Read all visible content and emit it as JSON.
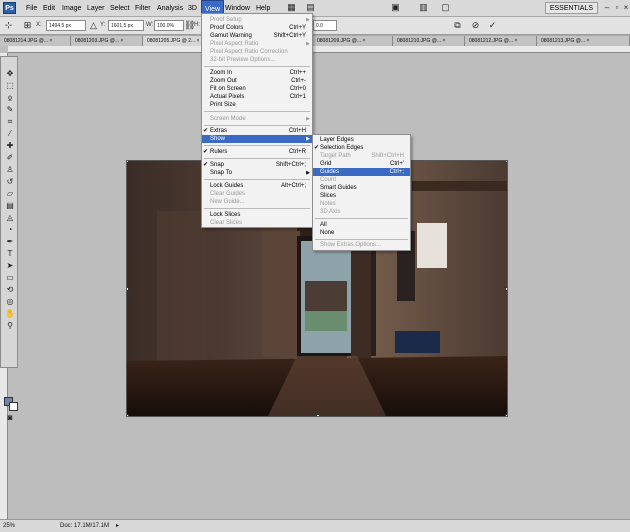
{
  "app": {
    "logo": "Ps"
  },
  "menubar": {
    "items": [
      "File",
      "Edit",
      "Image",
      "Layer",
      "Select",
      "Filter",
      "Analysis",
      "3D",
      "View",
      "Window",
      "Help"
    ],
    "workspace": "ESSENTIALS"
  },
  "options": {
    "x_label": "X:",
    "x_value": "1494.5 px",
    "y_label": "Y:",
    "y_value": "1601.5 px",
    "w_label": "W:",
    "w_value": "100.0%",
    "h_label": "H:",
    "v_value": "0.0"
  },
  "tabs": [
    "08081214.JPG @...",
    "08081203.JPG @...",
    "08081205.JPG @ 2...",
    "08081209.JPG @...",
    "08081210.JPG @...",
    "08081212.JPG @...",
    "08081213.JPG @..."
  ],
  "status": {
    "zoom": "25%",
    "doc": "Doc: 17.1M/17.1M"
  },
  "view_menu": {
    "items": [
      {
        "label": "Proof Setup",
        "shortcut": "",
        "disabled": true,
        "submenu": true
      },
      {
        "label": "Proof Colors",
        "shortcut": "Ctrl+Y"
      },
      {
        "label": "Gamut Warning",
        "shortcut": "Shift+Ctrl+Y"
      },
      {
        "label": "Pixel Aspect Ratio",
        "shortcut": "",
        "disabled": true,
        "submenu": true
      },
      {
        "label": "Pixel Aspect Ratio Correction",
        "shortcut": "",
        "disabled": true
      },
      {
        "label": "32-bit Preview Options...",
        "shortcut": "",
        "disabled": true
      },
      {
        "label": "Zoom In",
        "shortcut": "Ctrl++"
      },
      {
        "label": "Zoom Out",
        "shortcut": "Ctrl+-"
      },
      {
        "label": "Fit on Screen",
        "shortcut": "Ctrl+0"
      },
      {
        "label": "Actual Pixels",
        "shortcut": "Ctrl+1"
      },
      {
        "label": "Print Size",
        "shortcut": ""
      },
      {
        "label": "Screen Mode",
        "shortcut": "",
        "disabled": true,
        "submenu": true
      },
      {
        "label": "Extras",
        "shortcut": "Ctrl+H",
        "checked": true
      },
      {
        "label": "Show",
        "shortcut": "",
        "submenu": true,
        "highlighted": true
      },
      {
        "label": "Rulers",
        "shortcut": "Ctrl+R",
        "checked": true
      },
      {
        "label": "Snap",
        "shortcut": "Shift+Ctrl+;",
        "checked": true
      },
      {
        "label": "Snap To",
        "shortcut": "",
        "submenu": true
      },
      {
        "label": "Lock Guides",
        "shortcut": "Alt+Ctrl+;"
      },
      {
        "label": "Clear Guides",
        "shortcut": "",
        "disabled": true
      },
      {
        "label": "New Guide...",
        "shortcut": "",
        "disabled": true
      },
      {
        "label": "Lock Slices",
        "shortcut": ""
      },
      {
        "label": "Clear Slices",
        "shortcut": "",
        "disabled": true
      }
    ]
  },
  "show_menu": {
    "items": [
      {
        "label": "Layer Edges",
        "shortcut": ""
      },
      {
        "label": "Selection Edges",
        "shortcut": "",
        "checked": true
      },
      {
        "label": "Target Path",
        "shortcut": "Shift+Ctrl+H",
        "disabled": true
      },
      {
        "label": "Grid",
        "shortcut": "Ctrl+'"
      },
      {
        "label": "Guides",
        "shortcut": "Ctrl+;",
        "highlighted": true
      },
      {
        "label": "Count",
        "shortcut": "",
        "disabled": true
      },
      {
        "label": "Smart Guides",
        "shortcut": ""
      },
      {
        "label": "Slices",
        "shortcut": ""
      },
      {
        "label": "Notes",
        "shortcut": "",
        "disabled": true
      },
      {
        "label": "3D Axis",
        "shortcut": "",
        "disabled": true
      },
      {
        "label": "All",
        "shortcut": ""
      },
      {
        "label": "None",
        "shortcut": ""
      },
      {
        "label": "Show Extras Options...",
        "shortcut": "",
        "disabled": true
      }
    ]
  },
  "colors": {
    "highlight": "#3b6ac4",
    "foreground": "#6f86a8",
    "background": "#ffffff"
  }
}
